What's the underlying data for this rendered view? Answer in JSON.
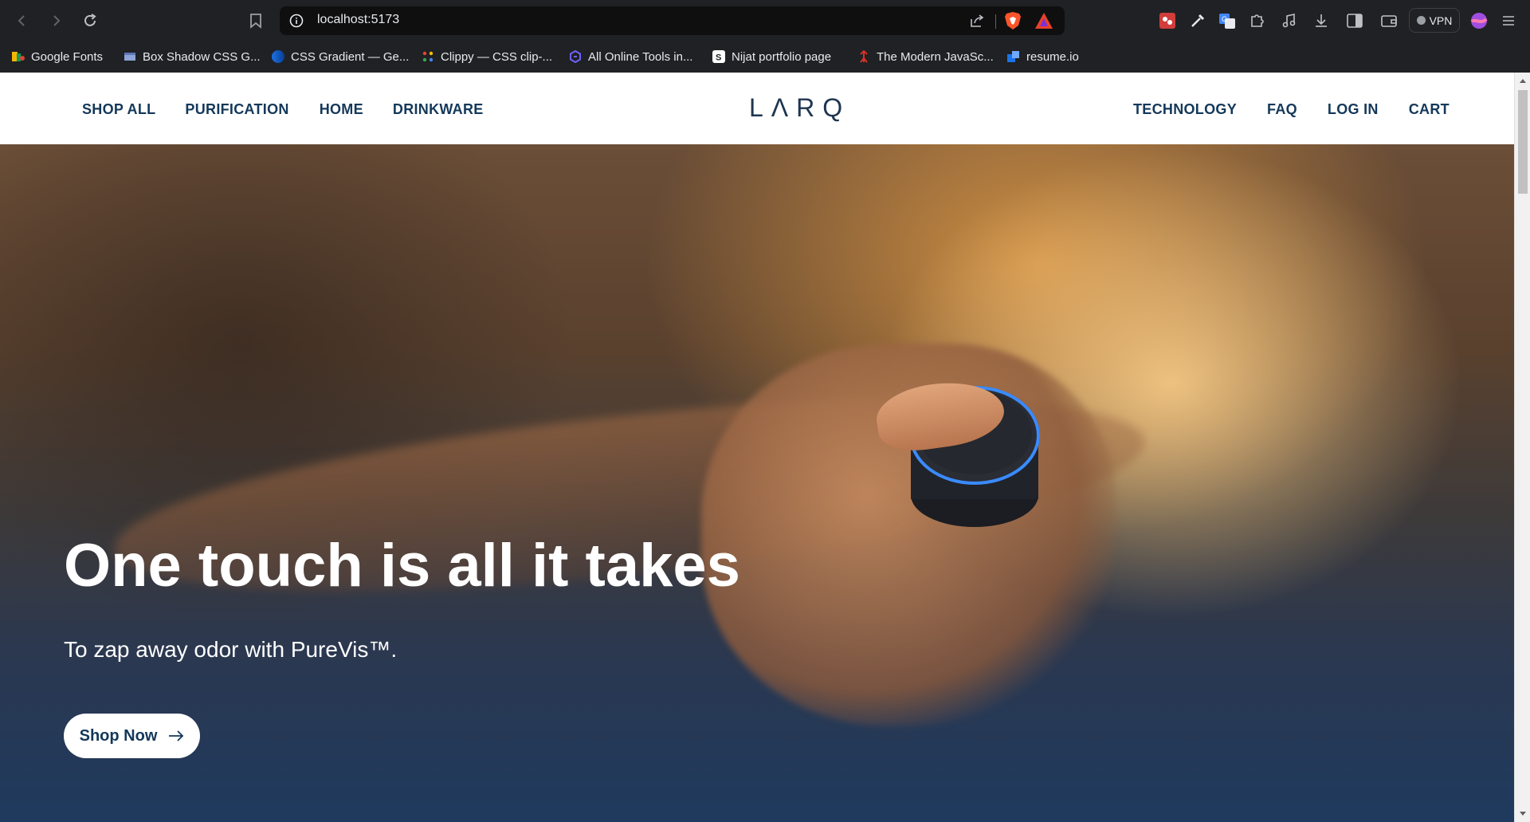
{
  "browser": {
    "url": "localhost:5173",
    "vpn_label": "VPN",
    "bookmarks": [
      {
        "label": "Google Fonts",
        "icon": "google-fonts-icon"
      },
      {
        "label": "Box Shadow CSS G...",
        "icon": "box-shadow-icon"
      },
      {
        "label": "CSS Gradient — Ge...",
        "icon": "css-gradient-icon"
      },
      {
        "label": "Clippy — CSS clip-...",
        "icon": "clippy-icon"
      },
      {
        "label": "All Online Tools in...",
        "icon": "online-tools-icon"
      },
      {
        "label": "Nijat portfolio page",
        "icon": "portfolio-icon"
      },
      {
        "label": "The Modern JavaSc...",
        "icon": "javascript-info-icon"
      },
      {
        "label": "resume.io",
        "icon": "resume-icon"
      }
    ]
  },
  "site": {
    "logo": "LΛRQ",
    "nav_left": [
      "SHOP ALL",
      "PURIFICATION",
      "HOME",
      "DRINKWARE"
    ],
    "nav_right": [
      "TECHNOLOGY",
      "FAQ",
      "LOG IN",
      "CART"
    ]
  },
  "hero": {
    "title": "One touch is all it takes",
    "subtitle": "To zap away odor with PureVis™.",
    "cta": "Shop Now",
    "cta_icon": "arrow-right-icon"
  },
  "colors": {
    "nav_text": "#14385a",
    "browser_bg": "#202124",
    "device_ring": "#3a8bff"
  }
}
